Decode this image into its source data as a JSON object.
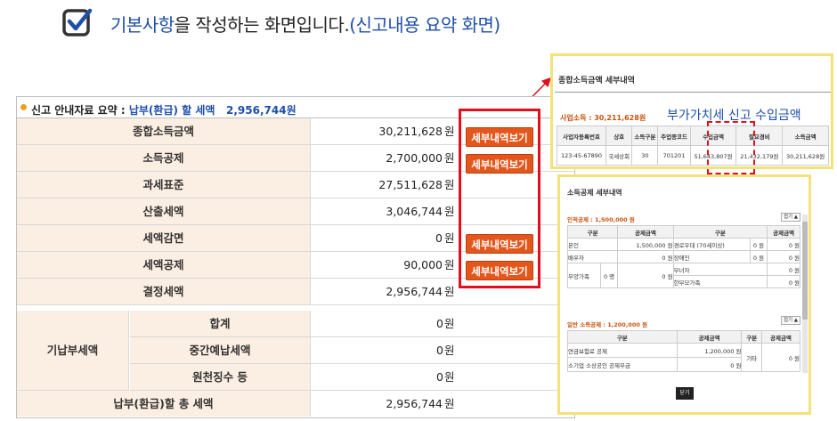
{
  "heading": {
    "part1": "기본사항",
    "part2": "을 작성하는 화면입니다.",
    "part3": "(신고내용 요약 화면)"
  },
  "summary": {
    "title_prefix": "신고 안내자료 요약 : ",
    "title_label": "납부(환급) 할 세액",
    "title_amount": "2,956,744원",
    "rows": [
      {
        "label": "종합소득금액",
        "value": "30,211,628",
        "unit": "원"
      },
      {
        "label": "소득공제",
        "value": "2,700,000",
        "unit": "원"
      },
      {
        "label": "과세표준",
        "value": "27,511,628",
        "unit": "원"
      },
      {
        "label": "산출세액",
        "value": "3,046,744",
        "unit": "원"
      },
      {
        "label": "세액감면",
        "value": "0",
        "unit": "원"
      },
      {
        "label": "세액공제",
        "value": "90,000",
        "unit": "원"
      },
      {
        "label": "결정세액",
        "value": "2,956,744",
        "unit": "원"
      }
    ],
    "group_label": "기납부세액",
    "group_rows": [
      {
        "label": "합계",
        "value": "0",
        "unit": "원"
      },
      {
        "label": "중간예납세액",
        "value": "0",
        "unit": "원"
      },
      {
        "label": "원천징수 등",
        "value": "0",
        "unit": "원"
      }
    ],
    "total": {
      "label": "납부(환급)할 총 세액",
      "value": "2,956,744",
      "unit": "원"
    },
    "detail_button": "세부내역보기"
  },
  "popup_income": {
    "title": "종합소득금액 세부내역",
    "caption": "부가가치세 신고 수입금액",
    "biz_label": "사업소득 : 30,211,628원",
    "headers": [
      "사업자등록번호",
      "상호",
      "소득구분",
      "주업종코드",
      "수입금액",
      "필요경비",
      "소득금액"
    ],
    "row": [
      "123-45-67890",
      "국세상회",
      "30",
      "701201",
      "51,643,807원",
      "21,432,179원",
      "30,211,628원"
    ]
  },
  "popup_deduction": {
    "title": "소득공제 세부내역",
    "sec1": "인적공제 : 1,500,000 원",
    "sec2": "일반 소득공제 : 1,200,000 원",
    "fold": "접기 ▲",
    "h_gubun": "구분",
    "h_amount": "공제금액",
    "r1a": "본인",
    "r1b": "1,500,000 원",
    "r1c": "경로우대 (70세이상)",
    "r1d": "0 원",
    "r1e": "0 원",
    "r2a": "배우자",
    "r2b": "0 원",
    "r2c": "장애인",
    "r2d": "0 원",
    "r2e": "0 원",
    "r3c": "부녀자",
    "r3e": "0 원",
    "r4a": "부양가족",
    "r4b": "0 명",
    "r4c": "0 원",
    "r4d": "한부모가족",
    "r4e": "0 원",
    "s1a": "연금보험료 공제",
    "s1b": "1,200,000 원",
    "s1c": "기타",
    "s1d": "0 원",
    "s2a": "소기업 소상공인 공제부금",
    "s2b": "0 원",
    "close": "닫기"
  },
  "colors": {
    "accent_button": "#e4571c",
    "label_bg": "#fbeee2",
    "highlight_red": "#e0101e",
    "popup_border": "#f3e27a",
    "brand_blue": "#1f4fa8"
  }
}
